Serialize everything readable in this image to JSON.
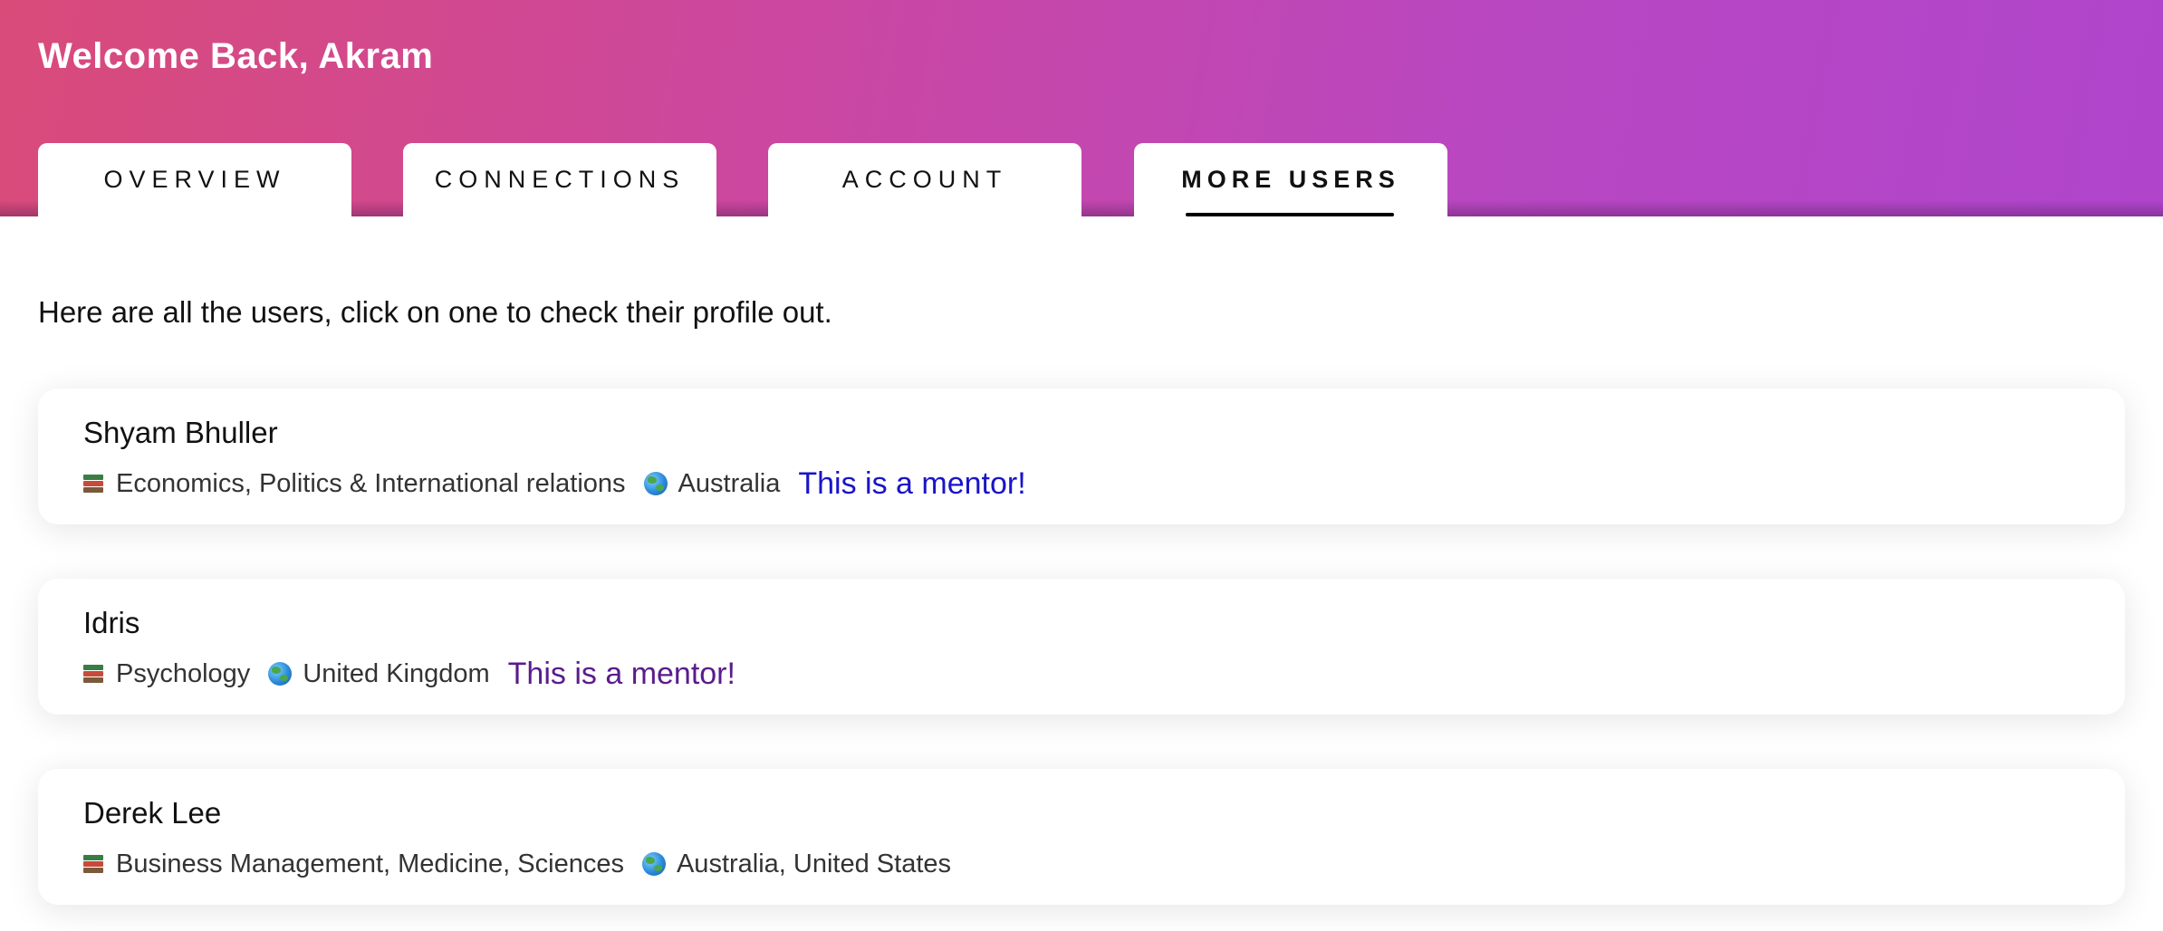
{
  "header": {
    "welcome": "Welcome Back, Akram"
  },
  "tabs": [
    {
      "label": "OVERVIEW",
      "active": false
    },
    {
      "label": "CONNECTIONS",
      "active": false
    },
    {
      "label": "ACCOUNT",
      "active": false
    },
    {
      "label": "MORE USERS",
      "active": true
    }
  ],
  "intro": "Here are all the users, click on one to check their profile out.",
  "icons": {
    "subjects": "books-icon",
    "location": "globe-icon"
  },
  "users": [
    {
      "name": "Shyam Bhuller",
      "subjects": "Economics, Politics & International relations",
      "location": "Australia",
      "mentor_label": "This is a mentor!",
      "mentor_color": "#1a14c8"
    },
    {
      "name": "Idris",
      "subjects": "Psychology",
      "location": "United Kingdom",
      "mentor_label": "This is a mentor!",
      "mentor_color": "#5a1c8c"
    },
    {
      "name": "Derek Lee",
      "subjects": "Business Management, Medicine, Sciences",
      "location": "Australia, United States"
    }
  ],
  "colors": {
    "gradient_start": "#d94b79",
    "gradient_end": "#b045cc"
  }
}
